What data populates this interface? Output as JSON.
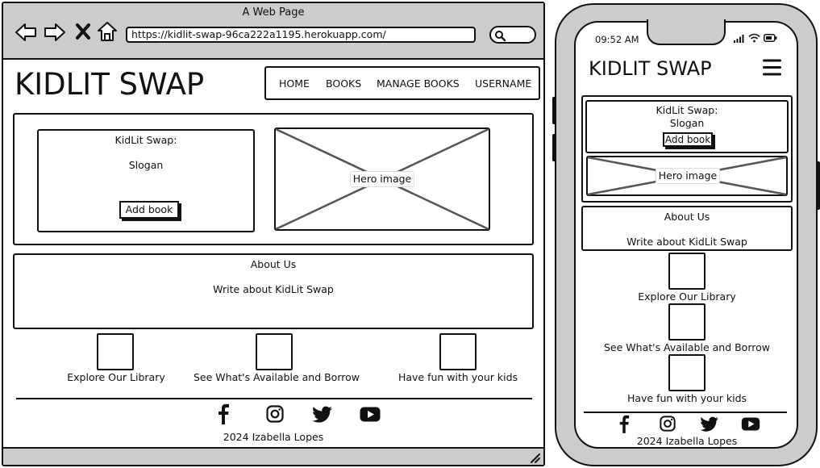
{
  "browser": {
    "window_title": "A Web Page",
    "url": "https://kidlit-swap-96ca222a1195.herokuapp.com/"
  },
  "site": {
    "logo": "KIDLIT SWAP",
    "nav": [
      "HOME",
      "BOOKS",
      "MANAGE BOOKS",
      "USERNAME"
    ]
  },
  "hero": {
    "title": "KidLit Swap:",
    "slogan": "Slogan",
    "button": "Add book",
    "image_label": "Hero image"
  },
  "about": {
    "title": "About Us",
    "text": "Write about KidLit Swap"
  },
  "features": [
    "Explore Our Library",
    "See What's Available and Borrow",
    "Have fun with your kids"
  ],
  "social_icons": [
    "facebook-icon",
    "instagram-icon",
    "twitter-icon",
    "youtube-icon"
  ],
  "footer": {
    "copyright": "2024 Izabella Lopes"
  },
  "phone": {
    "time": "09:52 AM",
    "menu_icon": "hamburger-icon"
  }
}
